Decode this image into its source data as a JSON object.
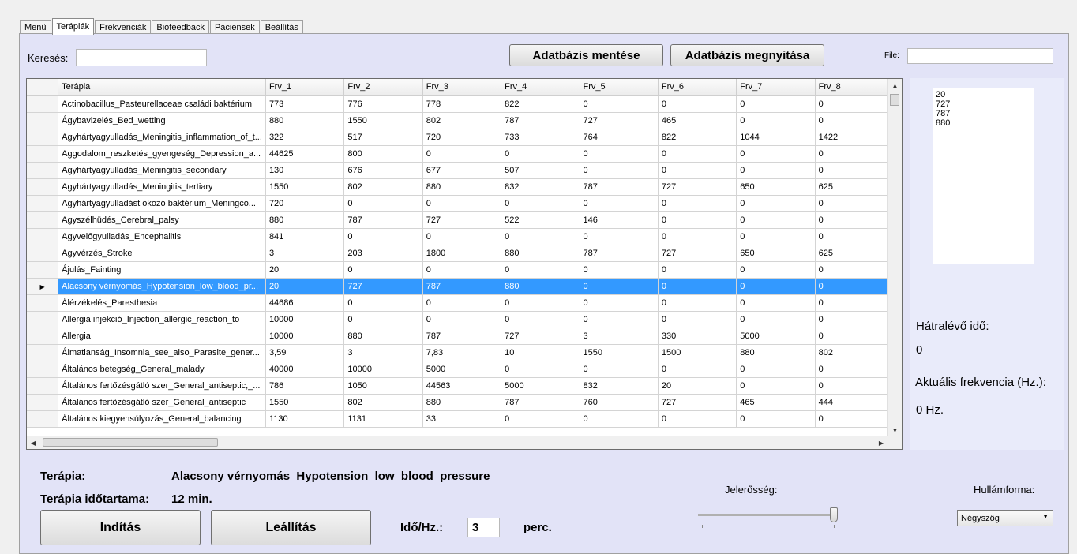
{
  "tabs": [
    "Menü",
    "Terápiák",
    "Frekvenciák",
    "Biofeedback",
    "Paciensek",
    "Beállítás"
  ],
  "search": {
    "label": "Keresés:",
    "value": ""
  },
  "toolbar": {
    "save_db": "Adatbázis mentése",
    "open_db": "Adatbázis megnyitása",
    "file_label": "File:",
    "file_value": ""
  },
  "grid": {
    "columns": [
      "Terápia",
      "Frv_1",
      "Frv_2",
      "Frv_3",
      "Frv_4",
      "Frv_5",
      "Frv_6",
      "Frv_7",
      "Frv_8"
    ],
    "selected_row": 11,
    "rows": [
      [
        "Actinobacillus_Pasteurellaceae családi baktérium",
        "773",
        "776",
        "778",
        "822",
        "0",
        "0",
        "0",
        "0"
      ],
      [
        "Ágybavizelés_Bed_wetting",
        "880",
        "1550",
        "802",
        "787",
        "727",
        "465",
        "0",
        "0"
      ],
      [
        "Agyhártyagyulladás_Meningitis_inflammation_of_t...",
        "322",
        "517",
        "720",
        "733",
        "764",
        "822",
        "1044",
        "1422"
      ],
      [
        "Aggodalom_reszketés_gyengeség_Depression_a...",
        "44625",
        "800",
        "0",
        "0",
        "0",
        "0",
        "0",
        "0"
      ],
      [
        "Agyhártyagyulladás_Meningitis_secondary",
        "130",
        "676",
        "677",
        "507",
        "0",
        "0",
        "0",
        "0"
      ],
      [
        "Agyhártyagyulladás_Meningitis_tertiary",
        "1550",
        "802",
        "880",
        "832",
        "787",
        "727",
        "650",
        "625"
      ],
      [
        "Agyhártyagyulladást okozó baktérium_Meningco...",
        "720",
        "0",
        "0",
        "0",
        "0",
        "0",
        "0",
        "0"
      ],
      [
        "Agyszélhüdés_Cerebral_palsy",
        "880",
        "787",
        "727",
        "522",
        "146",
        "0",
        "0",
        "0"
      ],
      [
        "Agyvelőgyulladás_Encephalitis",
        "841",
        "0",
        "0",
        "0",
        "0",
        "0",
        "0",
        "0"
      ],
      [
        "Agyvérzés_Stroke",
        "3",
        "203",
        "1800",
        "880",
        "787",
        "727",
        "650",
        "625"
      ],
      [
        "Ájulás_Fainting",
        "20",
        "0",
        "0",
        "0",
        "0",
        "0",
        "0",
        "0"
      ],
      [
        "Alacsony vérnyomás_Hypotension_low_blood_pr...",
        "20",
        "727",
        "787",
        "880",
        "0",
        "0",
        "0",
        "0"
      ],
      [
        "Álérzékelés_Paresthesia",
        "44686",
        "0",
        "0",
        "0",
        "0",
        "0",
        "0",
        "0"
      ],
      [
        "Allergia injekció_Injection_allergic_reaction_to",
        "10000",
        "0",
        "0",
        "0",
        "0",
        "0",
        "0",
        "0"
      ],
      [
        "Allergia",
        "10000",
        "880",
        "787",
        "727",
        "3",
        "330",
        "5000",
        "0"
      ],
      [
        "Álmatlanság_Insomnia_see_also_Parasite_gener...",
        "3,59",
        "3",
        "7,83",
        "10",
        "1550",
        "1500",
        "880",
        "802"
      ],
      [
        "Általános betegség_General_malady",
        "40000",
        "10000",
        "5000",
        "0",
        "0",
        "0",
        "0",
        "0"
      ],
      [
        "Általános fertőzésgátló szer_General_antiseptic,_...",
        "786",
        "1050",
        "44563",
        "5000",
        "832",
        "20",
        "0",
        "0"
      ],
      [
        "Általános fertőzésgátló szer_General_antiseptic",
        "1550",
        "802",
        "880",
        "787",
        "760",
        "727",
        "465",
        "444"
      ],
      [
        "Általános kiegyensúlyozás_General_balancing",
        "1130",
        "1131",
        "33",
        "0",
        "0",
        "0",
        "0",
        "0"
      ]
    ]
  },
  "side": {
    "list": [
      "20",
      "727",
      "787",
      "880"
    ],
    "remaining_label": "Hátralévő idő:",
    "remaining_value": "0",
    "freq_label": "Aktuális frekvencia (Hz.):",
    "freq_value": "0 Hz."
  },
  "bottom": {
    "therapy_label": "Terápia:",
    "therapy_value": "Alacsony vérnyomás_Hypotension_low_blood_pressure",
    "duration_label": "Terápia időtartama:",
    "duration_value": "12 min.",
    "start": "Indítás",
    "stop": "Leállítás",
    "time_label": "Idő/Hz.:",
    "time_value": "3",
    "time_unit": "perc.",
    "signal_label": "Jelerősség:",
    "signal_level": 1.0,
    "wave_label": "Hullámforma:",
    "wave_value": "Négyszög"
  }
}
